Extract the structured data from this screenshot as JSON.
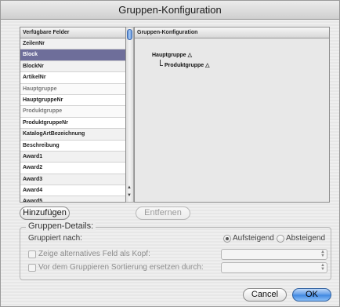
{
  "window": {
    "title": "Gruppen-Konfiguration"
  },
  "fields": {
    "header": "Verfügbare Felder",
    "items": [
      {
        "label": "ZeilenNr",
        "state": "normal"
      },
      {
        "label": "Block",
        "state": "selected"
      },
      {
        "label": "BlockNr",
        "state": "normal"
      },
      {
        "label": "ArtikelNr",
        "state": "normal"
      },
      {
        "label": "Hauptgruppe",
        "state": "dim"
      },
      {
        "label": "HauptgruppeNr",
        "state": "normal"
      },
      {
        "label": "Produktgruppe",
        "state": "dim"
      },
      {
        "label": "ProduktgruppeNr",
        "state": "normal"
      },
      {
        "label": "KatalogArtBezeichnung",
        "state": "normal"
      },
      {
        "label": "Beschreibung",
        "state": "normal"
      },
      {
        "label": "Award1",
        "state": "normal"
      },
      {
        "label": "Award2",
        "state": "normal"
      },
      {
        "label": "Award3",
        "state": "normal"
      },
      {
        "label": "Award4",
        "state": "normal"
      },
      {
        "label": "Award5",
        "state": "normal"
      }
    ]
  },
  "tree": {
    "header": "Gruppen-Konfiguration",
    "root": "Hauptgruppe",
    "child": "Produktgruppe",
    "expand_glyph": "△"
  },
  "buttons": {
    "add": "Hinzufügen",
    "remove": "Entfernen",
    "cancel": "Cancel",
    "ok": "OK"
  },
  "details": {
    "legend": "Gruppen-Details:",
    "grouped_by": "Gruppiert nach:",
    "asc": "Aufsteigend",
    "desc": "Absteigend",
    "sort_selected": "Aufsteigend",
    "alt_field": "Zeige alternatives Feld als Kopf:",
    "replace_sort": "Vor dem Gruppieren Sortierung ersetzen durch:",
    "alt_field_value": "",
    "replace_sort_value": ""
  },
  "colors": {
    "selection": "#6e6e9a",
    "primary_button": "#3d86e0"
  }
}
